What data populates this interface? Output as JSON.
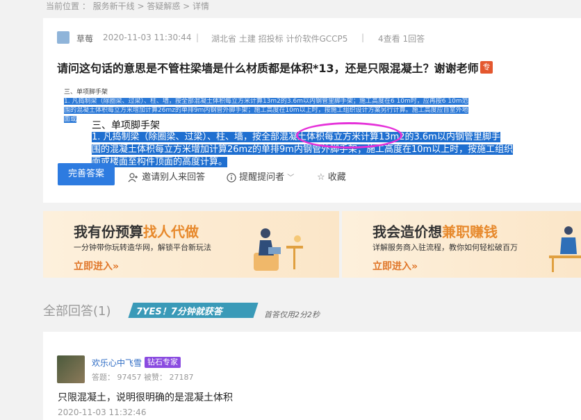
{
  "breadcrumb": "当前位置 ： 服务新干线 > 答疑解惑 > 详情",
  "question": {
    "user": "草莓",
    "time": "2020-11-03 11:30:44",
    "sep": "|",
    "location": "湖北省  土建 招投标 计价软件GCCP5",
    "views": "4查看  1回答",
    "title": "请问这句话的意思是不管柱梁墙是什么材质都是体积*13，还是只限混凝土？谢谢老师",
    "badge": "专"
  },
  "small_text": {
    "heading": "三、单项脚手架",
    "line1": "1. 凡捣制梁（除圈梁、过梁）、柱、墙，按全部混凝土体积每立方米计算13m2的3.6m以内钢管里脚手架；施工高度在6 10m时，应再按6 10m范",
    "line2": "围的混凝土体积每立方米增加计算26mz的单排9m内钢管外脚手架；施工高度在10m以上时，按施工组织设计方案另行计算。施工高度应自室外地",
    "line3": "面或"
  },
  "zoom_text": {
    "heading": "三、单项脚手架",
    "line1": "1. 凡捣制梁（除圈梁、过梁）、柱、墙，按全部混凝土体积每立方米计算13m2的3.6m以内钢管里脚手",
    "line2": "围的混凝土体积每立方米增加计算26mz的单排9m内钢管外脚手架；施工高度在10m以上时，按施工组织",
    "line3": "面或楼面至构件顶面的高度计算。"
  },
  "actions": {
    "complete": "完善答案",
    "invite": "邀请别人来回答",
    "remind": "提醒提问者",
    "remind_arrow": "﹀",
    "fav": "收藏"
  },
  "banners": [
    {
      "title_a": "我有份预算",
      "title_b": "找人代做",
      "sub": "一分钟带你玩转造华网，解锁平台新玩法",
      "link": "立即进入»"
    },
    {
      "title_a": "我会造价想",
      "title_b": "兼职赚钱",
      "sub": "详解服务商入驻流程，教你如何轻松破百万",
      "link": "立即进入»"
    }
  ],
  "answers_header": "全部回答(1)",
  "yes_badge": "7YES！7分钟就获答",
  "first_answer_time": "首答仅用2分2秒",
  "answer": {
    "name": "欢乐心中飞雪",
    "badge": "钻石专家",
    "stats": "答题： 97457    被赞： 27187",
    "content": "只限混凝土，说明很明确的是混凝土体积",
    "time": "2020-11-03 11:32:46"
  },
  "colors": {
    "primary": "#2d7be0",
    "accent": "#e7892c",
    "circle": "#e531d9",
    "highlight": "#1f6fd0"
  }
}
